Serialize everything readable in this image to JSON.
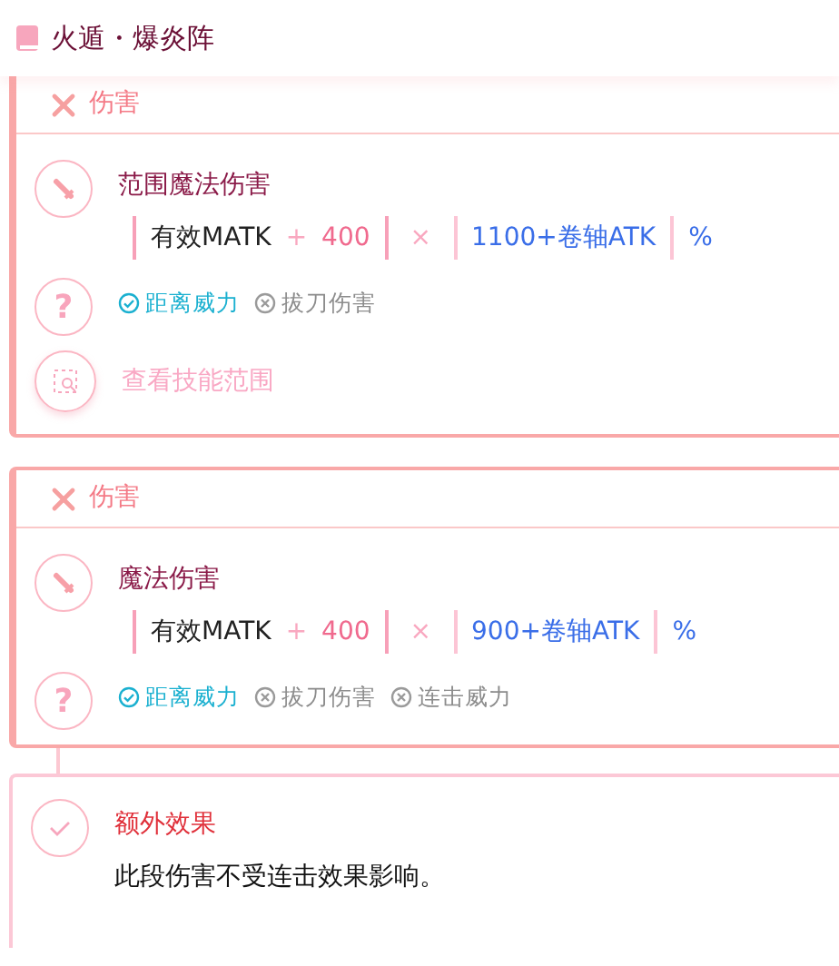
{
  "header": {
    "title": "火遁・爆炎阵"
  },
  "cards": [
    {
      "heading": "伤害",
      "name": "范围魔法伤害",
      "formula": {
        "base": "有效MATK",
        "plus": "+",
        "constant": "400",
        "times": "×",
        "ratio": "1100+卷轴ATK",
        "unit": "%"
      },
      "help": "?",
      "tags": [
        {
          "label": "距离威力",
          "on": true
        },
        {
          "label": "拔刀伤害",
          "on": false
        }
      ],
      "action": "查看技能范围"
    },
    {
      "heading": "伤害",
      "name": "魔法伤害",
      "formula": {
        "base": "有效MATK",
        "plus": "+",
        "constant": "400",
        "times": "×",
        "ratio": "900+卷轴ATK",
        "unit": "%"
      },
      "help": "?",
      "tags": [
        {
          "label": "距离威力",
          "on": true
        },
        {
          "label": "拔刀伤害",
          "on": false
        },
        {
          "label": "连击威力",
          "on": false
        }
      ]
    }
  ],
  "extra": {
    "title": "额外效果",
    "text": "此段伤害不受连击效果影响。"
  }
}
